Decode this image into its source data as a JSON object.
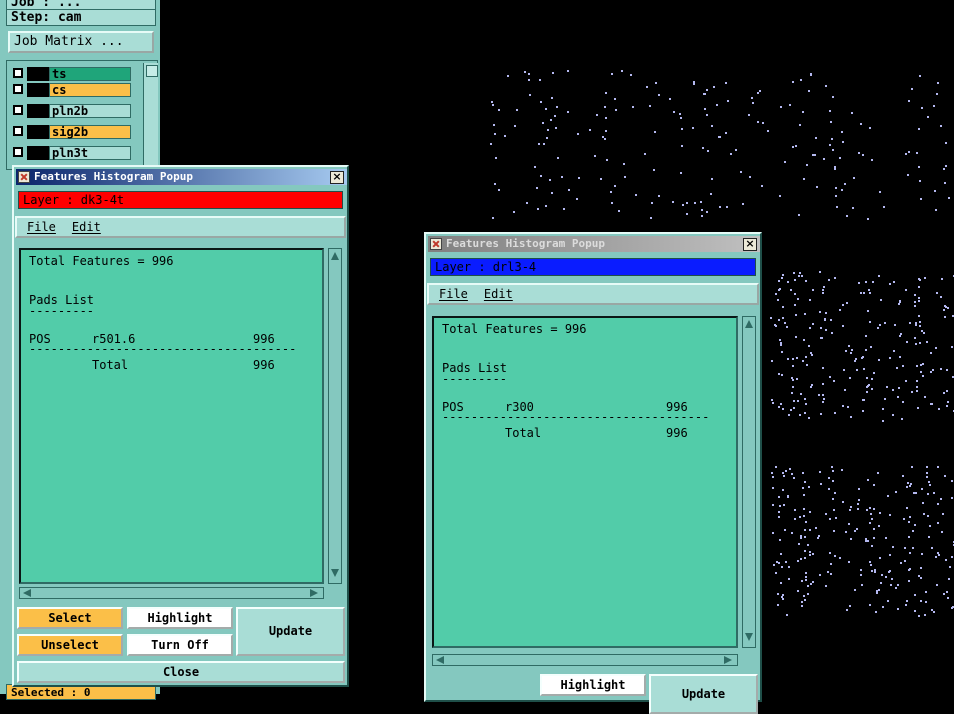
{
  "sidebar": {
    "job_label": "Job : ...",
    "step_label": "Step: cam",
    "job_matrix_button": "Job Matrix ...",
    "layers": [
      {
        "name": "ts",
        "color": "#1fa57a"
      },
      {
        "name": "cs",
        "color": "#fbbf48"
      },
      {
        "name": "pln2b",
        "color": "#a9ddd6"
      },
      {
        "name": "sig2b",
        "color": "#fbbf48"
      },
      {
        "name": "pln3t",
        "color": "#a9ddd6"
      }
    ],
    "selected_label": "Selected : 0"
  },
  "popup_left": {
    "title": "Features Histogram Popup",
    "layer_label": "Layer :  dk3-4t",
    "layer_color": "#ff0000",
    "menu": {
      "file": "File",
      "edit": "Edit"
    },
    "total_features": "Total Features = 996",
    "pads_list": "Pads List",
    "pads_rule": "---------",
    "row_type": "POS",
    "row_symbol": "r501.6",
    "row_count": "996",
    "rule": "------------------------------------------",
    "total_label": "Total",
    "total_count": "996",
    "buttons": {
      "select": "Select",
      "highlight": "Highlight",
      "unselect": "Unselect",
      "turn_off": "Turn Off",
      "update": "Update",
      "close": "Close"
    }
  },
  "popup_right": {
    "title": "Features Histogram Popup",
    "layer_label": "Layer :  drl3-4",
    "layer_color": "#0a1cff",
    "menu": {
      "file": "File",
      "edit": "Edit"
    },
    "total_features": "Total Features = 996",
    "pads_list": "Pads List",
    "pads_rule": "---------",
    "row_type": "POS",
    "row_symbol": "r300",
    "row_count": "996",
    "rule": "------------------------------------------",
    "total_label": "Total",
    "total_count": "996",
    "buttons": {
      "highlight": "Highlight",
      "update": "Update"
    }
  }
}
